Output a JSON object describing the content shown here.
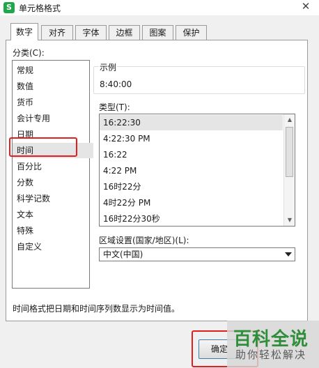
{
  "window": {
    "icon_text": "S",
    "title": "单元格格式",
    "close_glyph": "✕"
  },
  "tabs": [
    {
      "label": "数字",
      "active": true
    },
    {
      "label": "对齐"
    },
    {
      "label": "字体"
    },
    {
      "label": "边框"
    },
    {
      "label": "图案"
    },
    {
      "label": "保护"
    }
  ],
  "category": {
    "label": "分类(C):",
    "items": [
      "常规",
      "数值",
      "货币",
      "会计专用",
      "日期",
      "时间",
      "百分比",
      "分数",
      "科学记数",
      "文本",
      "特殊",
      "自定义"
    ],
    "selected": "时间"
  },
  "sample": {
    "label": "示例",
    "value": "8:40:00"
  },
  "type": {
    "label": "类型(T):",
    "items": [
      "16:22:30",
      "4:22:30 PM",
      "16:22",
      "4:22 PM",
      "16时22分",
      "4时22分 PM",
      "16时22分30秒"
    ],
    "selected": "16:22:30"
  },
  "region": {
    "label": "区域设置(国家/地区)(L):",
    "value": "中文(中国)"
  },
  "description": "时间格式把日期和时间序列数显示为时间值。",
  "buttons": {
    "ok_label": "确定"
  },
  "watermark": {
    "main": "百科全说",
    "sub": "助你轻松解决"
  },
  "colors": {
    "highlight": "#e02020",
    "watermark_green": "#2f8e3a",
    "app_icon": "#1fa74c"
  }
}
